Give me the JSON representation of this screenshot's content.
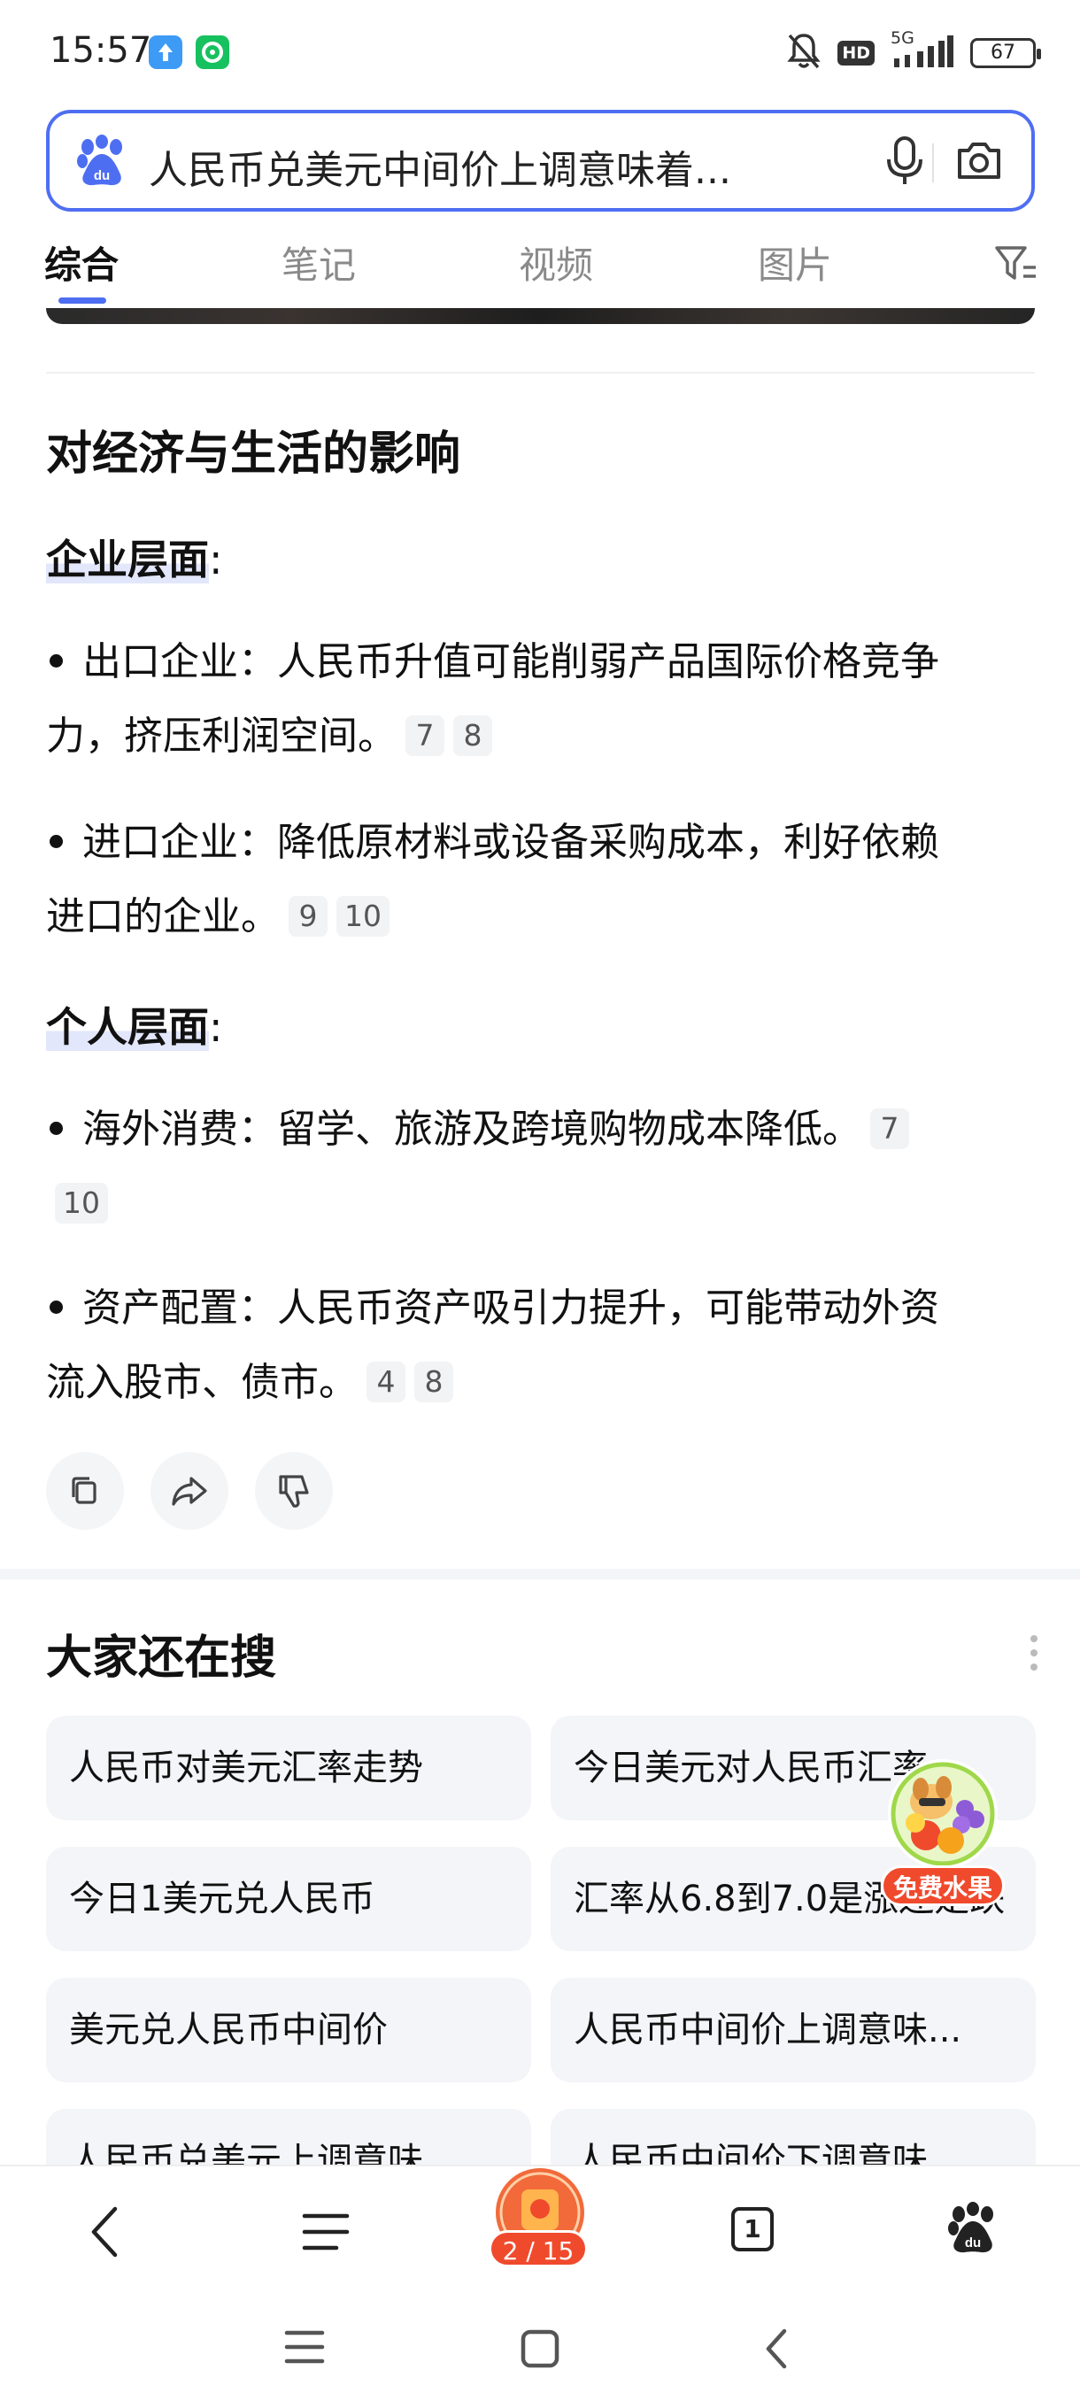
{
  "status_bar": {
    "time": "15:57",
    "network": "5G",
    "hd": "HD",
    "battery": "67"
  },
  "search": {
    "query": "人民币兑美元中间价上调意味着..."
  },
  "tabs": [
    "综合",
    "笔记",
    "视频",
    "图片"
  ],
  "content": {
    "heading": "对经济与生活的影响",
    "sections": [
      {
        "title": "企业层面",
        "items": [
          {
            "line1": "出口企业：人民币升值可能削弱产品国际价格竞争",
            "line2": "力，挤压利润空间。",
            "cites": [
              "7",
              "8"
            ]
          },
          {
            "line1": "进口企业：降低原材料或设备采购成本，利好依赖",
            "line2": "进口的企业。",
            "cites": [
              "9",
              "10"
            ]
          }
        ]
      },
      {
        "title": "个人层面",
        "items": [
          {
            "line1": "海外消费：留学、旅游及跨境购物成本降低。",
            "cite_inline": "7",
            "cite_next": "10"
          },
          {
            "line1": "资产配置：人民币资产吸引力提升，可能带动外资",
            "line2": "流入股市、债市。",
            "cites": [
              "4",
              "8"
            ]
          }
        ]
      }
    ],
    "colon": ":"
  },
  "related": {
    "title": "大家还在搜",
    "chips": [
      "人民币对美元汇率走势",
      "今日美元对人民币汇率",
      "今日1美元兑人民币",
      "汇率从6.8到7.0是涨还是跌",
      "美元兑人民币中间价",
      "人民币中间价上调意味...",
      "人民币兑美元上调意味...",
      "人民币中间价下调意味..."
    ]
  },
  "floating_promo": {
    "label": "免费水果"
  },
  "bottom_bar": {
    "page_badge": "2 / 15",
    "tab_count": "1"
  },
  "colors": {
    "accent": "#4e6ef2",
    "badge": "#f04a2d"
  }
}
